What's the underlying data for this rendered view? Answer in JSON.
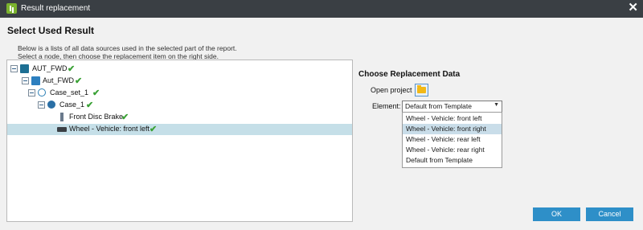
{
  "window": {
    "title": "Result replacement",
    "close_icon": "close-icon"
  },
  "left": {
    "heading": "Select Used Result",
    "description": [
      "Below is a lists of all data sources used in the selected part of the report.",
      "Select a node, then choose the replacement item on the right side."
    ],
    "tree": [
      {
        "label": "AUT_FWD",
        "icon": "project-icon",
        "check": "✔"
      },
      {
        "label": "Aut_FWD",
        "icon": "model-icon",
        "check": "✔"
      },
      {
        "label": "Case_set_1",
        "icon": "case-set-icon",
        "check": "✔"
      },
      {
        "label": "Case_1",
        "icon": "case-icon",
        "check": "✔"
      },
      {
        "label": "Front Disc Brake",
        "icon": "brake-icon",
        "check": "✔"
      },
      {
        "label": "Wheel - Vehicle: front left",
        "icon": "wheel-icon",
        "check": "✔",
        "selected": true
      }
    ]
  },
  "right": {
    "heading": "Choose Replacement Data",
    "open_project_label": "Open project",
    "element_label": "Element:",
    "element_value": "Default from Template",
    "options": [
      "Wheel - Vehicle: front left",
      "Wheel - Vehicle: front right",
      "Wheel - Vehicle: rear left",
      "Wheel - Vehicle: rear right",
      "Default from Template"
    ],
    "highlighted_option": "Wheel - Vehicle: front right"
  },
  "buttons": {
    "ok": "OK",
    "cancel": "Cancel"
  },
  "colors": {
    "titlebar": "#3a3f44",
    "accent": "#2e8fc8",
    "selection": "#c5dfe8",
    "check": "#3aa135"
  }
}
